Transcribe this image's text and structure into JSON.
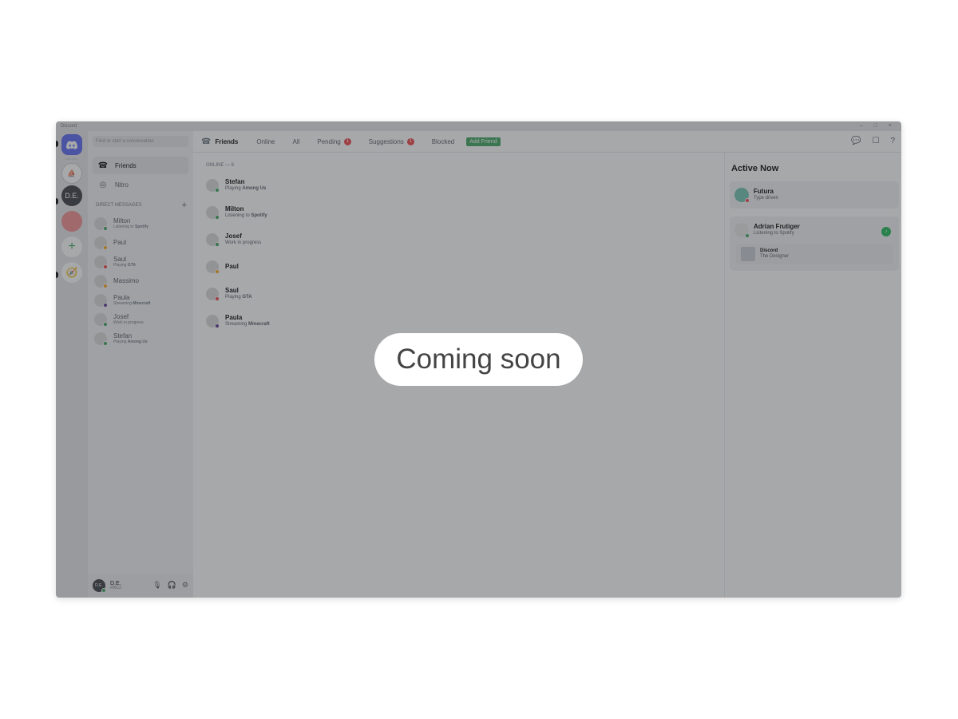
{
  "window": {
    "title": "Discord",
    "controls": "– □ ×"
  },
  "guilds": {
    "home_icon": "discord-logo-icon",
    "server_1": "",
    "server_2": "D.E.",
    "server_3": "",
    "add": "+",
    "explore": "⊘"
  },
  "channels": {
    "search_placeholder": "Find or start a conversation",
    "friends_label": "Friends",
    "nitro_label": "Nitro",
    "dm_header": "DIRECT MESSAGES",
    "dm_add": "+"
  },
  "dms": [
    {
      "name": "Milton",
      "sub_prefix": "Listening to ",
      "sub_bold": "Spotify",
      "status_color": "#3ba55d"
    },
    {
      "name": "Paul",
      "sub_prefix": "",
      "sub_bold": "",
      "status_color": "#faa81a"
    },
    {
      "name": "Saul",
      "sub_prefix": "Playing ",
      "sub_bold": "GTA",
      "status_color": "#ed4245"
    },
    {
      "name": "Massimo",
      "sub_prefix": "",
      "sub_bold": "",
      "status_color": "#faa81a"
    },
    {
      "name": "Paula",
      "sub_prefix": "Streaming ",
      "sub_bold": "Minecraft",
      "status_color": "#593695"
    },
    {
      "name": "Josef",
      "sub_prefix": "Work in progress",
      "sub_bold": "",
      "status_color": "#3ba55d"
    },
    {
      "name": "Stefan",
      "sub_prefix": "Playing ",
      "sub_bold": "Among Us",
      "status_color": "#3ba55d"
    }
  ],
  "user": {
    "avatar_text": "D.E.",
    "name": "D.E.",
    "tag": "#0012"
  },
  "topbar": {
    "title": "Friends",
    "tabs": [
      "Online",
      "All",
      "Pending",
      "Suggestions",
      "Blocked"
    ],
    "pending_badge": "1",
    "suggestions_badge": "1",
    "add_friend": "Add Friend"
  },
  "online_header": "ONLINE — 6",
  "friends": [
    {
      "name": "Stefan",
      "sub_prefix": "Playing ",
      "sub_bold": "Among Us",
      "status_color": "#3ba55d"
    },
    {
      "name": "Milton",
      "sub_prefix": "Listening to ",
      "sub_bold": "Spotify",
      "status_color": "#3ba55d"
    },
    {
      "name": "Josef",
      "sub_prefix": "Work in progress",
      "sub_bold": "",
      "status_color": "#3ba55d"
    },
    {
      "name": "Paul",
      "sub_prefix": "",
      "sub_bold": "",
      "status_color": "#faa81a"
    },
    {
      "name": "Saul",
      "sub_prefix": "Playing ",
      "sub_bold": "GTA",
      "status_color": "#ed4245"
    },
    {
      "name": "Paula",
      "sub_prefix": "Streaming ",
      "sub_bold": "Minecraft",
      "status_color": "#593695"
    }
  ],
  "active_now": {
    "title": "Active Now",
    "cards": [
      {
        "name": "Futura",
        "sub": "Type driven"
      },
      {
        "name": "Adrian Frutiger",
        "sub": "Listening to Spotify",
        "track_title": "Discord",
        "track_artist": "The Designer"
      }
    ]
  },
  "overlay_text": "Coming soon",
  "colors": {
    "brand": "#5865f2",
    "online": "#3ba55d",
    "badge": "#ed4245",
    "spotify": "#1db954"
  }
}
